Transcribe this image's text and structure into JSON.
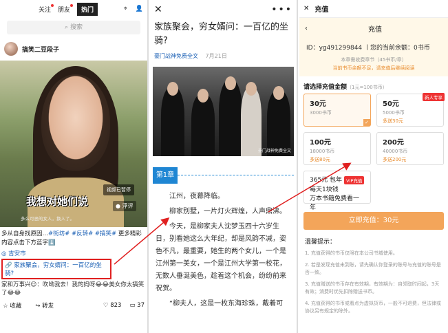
{
  "feed": {
    "tabs": [
      {
        "label": "关注",
        "dot": true
      },
      {
        "label": "朋友",
        "dot": true
      },
      {
        "label": "热门",
        "active": true
      }
    ],
    "search_placeholder": "搜索",
    "poster_name": "搞笑二豆段子",
    "video_subtitle": "我想对她们说",
    "video_small_text": "多么可恶的女人，换人了。",
    "video_paused": "视频已暂停",
    "pip_label": "浮评",
    "caption_prefix": "多从自身找原因…",
    "caption_tags": "#街坊# #反转# #搞笑#",
    "caption_suffix": " 更多精彩内容点击下方蓝字⬇️",
    "location": "吉安市",
    "link_text": "家族聚会，穷女婿问：一百亿的坐骑?",
    "comment": "家和万事兴😊：吹呦我去！我的妈呀😂😂美女你太搞笑了😂😂",
    "actions": {
      "favorite": "收藏",
      "share": "转发",
      "likes": "823",
      "comments": "37"
    }
  },
  "article": {
    "title": "家族聚会，穷女婿问：一百亿的坐骑?",
    "source": "豪门战神免费全文",
    "date": "7月21日",
    "image_watermark": "豪门战神免费全文",
    "chapter": "第1章",
    "paragraphs": [
      "江州，夜幕降临。",
      "柳家别墅，一片灯火辉煌，人声鼎沸。",
      "今天，是柳家夫人沈梦玉四十六岁生日，别看她这么大年纪，却是风韵不减，姿色不凡，最重要，她生的两个女儿，一个是江州第一美女，一个是江州大学第一校花，无数人垂涎美色，趁着这个机会，纷纷前来祝贺。",
      "“柳夫人，这是一枚东海珍珠，戴着可"
    ]
  },
  "recharge": {
    "window_title": "充值",
    "header_title": "充值",
    "id_line": "ID：yg491299844 丨您的当前余额：0书币",
    "note1": "本章需收费章节（45书币/章）",
    "note2": "当前书币余额不足，请充值后继续阅读",
    "pick_label": "请选择充值金额",
    "rate": "（1元=100书币）",
    "options": [
      {
        "price": "30元",
        "coins": "3000书币",
        "bonus": "",
        "badge": "",
        "selected": true
      },
      {
        "price": "50元",
        "coins": "5000书币",
        "bonus": "多送30元",
        "badge": "新人专享",
        "selected": false
      },
      {
        "price": "100元",
        "coins": "18000书币",
        "bonus": "多送80元",
        "badge": "",
        "selected": false
      },
      {
        "price": "200元",
        "coins": "40000书币",
        "bonus": "多送200元",
        "badge": "",
        "selected": false
      }
    ],
    "vip": {
      "price": "365元 包年",
      "badge": "VIP充值",
      "sub": "每天1块钱",
      "bonus": "万本书籍免费看一年"
    },
    "pay_button": "立即充值：30元",
    "tips_title": "温馨提示：",
    "tips": [
      "1. 充值获得的书币仅限在本公司书城使用。",
      "2. 若是发现充值未到账，请先确认你登录的账号与充值的账号是否一致。",
      "3. 充值赠送的书币存在有效期，有效期为：自领取时间起，3天有效；消费时优先扣除赠送书币。",
      "4. 充值获得的书币或看点为虚拟货币，一般不可退费，但法律或协议另有规定的除外。"
    ]
  },
  "colors": {
    "accent": "#f3a55a",
    "link": "#1a5fb4",
    "chapter": "#1f86d3",
    "highlight": "#e02020"
  }
}
